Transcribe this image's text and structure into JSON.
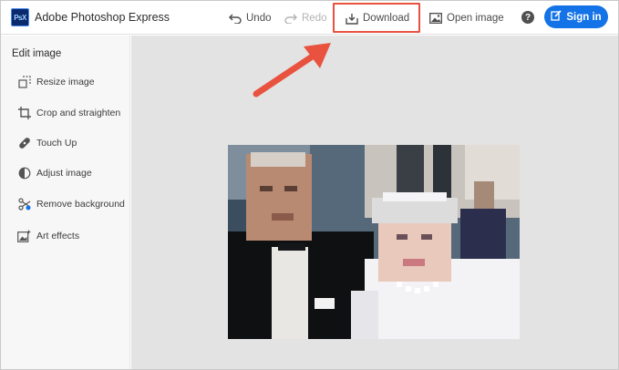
{
  "app": {
    "title": "Adobe Photoshop Express",
    "logo_text": "PsX"
  },
  "toolbar": {
    "undo_label": "Undo",
    "redo_label": "Redo",
    "download_label": "Download",
    "open_image_label": "Open image",
    "help_symbol": "?",
    "signin_label": "Sign in"
  },
  "sidebar": {
    "title": "Edit image",
    "items": [
      {
        "label": "Resize image",
        "icon": "resize-icon"
      },
      {
        "label": "Crop and straighten",
        "icon": "crop-icon"
      },
      {
        "label": "Touch Up",
        "icon": "bandage-icon"
      },
      {
        "label": "Adjust image",
        "icon": "adjust-icon"
      },
      {
        "label": "Remove background",
        "icon": "scissors-icon"
      },
      {
        "label": "Art effects",
        "icon": "art-effects-icon"
      }
    ]
  },
  "colors": {
    "accent": "#1473e6",
    "highlight": "#e8523f",
    "canvas_bg": "#e3e3e3",
    "sidebar_bg": "#f7f7f7"
  }
}
